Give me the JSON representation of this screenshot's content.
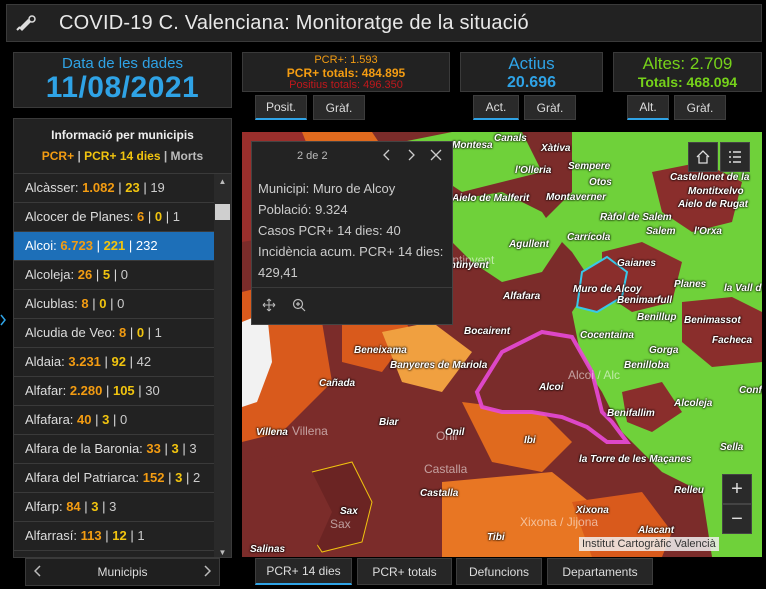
{
  "header": {
    "title": "COVID-19 C. Valenciana: Monitoratge de la situació"
  },
  "date_panel": {
    "label": "Data de les dades",
    "value": "11/08/2021"
  },
  "pcr_panel": {
    "line1": "PCR+: 1.593",
    "line2": "PCR+ totals: 484.895",
    "line3": "Positius totals: 496.350"
  },
  "actius_panel": {
    "label": "Actius",
    "value": "20.696"
  },
  "altes_panel": {
    "line1": "Altes: 2.709",
    "line2": "Totals: 468.094"
  },
  "tabs": {
    "posit": "Posit.",
    "graf1": "Gràf.",
    "act": "Act.",
    "graf2": "Gràf.",
    "alt": "Alt.",
    "graf3": "Gràf."
  },
  "municipis": {
    "title": "Informació per municipis",
    "legend_pcr": "PCR+",
    "legend_sep1": " | ",
    "legend_14": "PCR+ 14 dies",
    "legend_sep2": " | ",
    "legend_morts": "Morts",
    "sep": " | ",
    "rows": [
      {
        "name": "Alcàsser:",
        "a": "1.082",
        "b": "23",
        "c": "19"
      },
      {
        "name": "Alcocer de Planes:",
        "a": "6",
        "b": "0",
        "c": "1"
      },
      {
        "name": "Alcoi:",
        "a": "6.723",
        "b": "221",
        "c": "232"
      },
      {
        "name": "Alcoleja:",
        "a": "26",
        "b": "5",
        "c": "0"
      },
      {
        "name": "Alcublas:",
        "a": "8",
        "b": "0",
        "c": "0"
      },
      {
        "name": "Alcudia de Veo:",
        "a": "8",
        "b": "0",
        "c": "1"
      },
      {
        "name": "Aldaia:",
        "a": "3.231",
        "b": "92",
        "c": "42"
      },
      {
        "name": "Alfafar:",
        "a": "2.280",
        "b": "105",
        "c": "30"
      },
      {
        "name": "Alfafara:",
        "a": "40",
        "b": "3",
        "c": "0"
      },
      {
        "name": "Alfara de la Baronia:",
        "a": "33",
        "b": "3",
        "c": "3"
      },
      {
        "name": "Alfara del Patriarca:",
        "a": "152",
        "b": "3",
        "c": "2"
      },
      {
        "name": "Alfarp:",
        "a": "84",
        "b": "3",
        "c": "3"
      },
      {
        "name": "Alfarrasí:",
        "a": "113",
        "b": "12",
        "c": "1"
      }
    ],
    "nav_label": "Municipis"
  },
  "popup": {
    "counter": "2 de 2",
    "line1": "Municipi: Muro de Alcoy",
    "line2": "Població: 9.324",
    "line3": "Casos PCR+ 14 dies: 40",
    "line4": "Incidència acum. PCR+ 14 dies: 429,41"
  },
  "map": {
    "attribution": "Institut Cartogràfic Valencià",
    "labels": {
      "montesa": "Montesa",
      "canals": "Canals",
      "xativa": "Xàtiva",
      "lolleria": "l'Olleria",
      "sempere": "Sempere",
      "otos": "Otos",
      "castellonet": "Castellonet de la",
      "montitxelvo": "Montitxelvo",
      "aielo_salem": "Aielo de Rugat",
      "aielo_malferit": "Aielo de Malferit",
      "montaverner": "Montaverner",
      "rafol": "Ràfol de Salem",
      "salem": "Salem",
      "lorxa": "l'Orxa",
      "ontinyent_big": "Ontinyent",
      "agullent": "Agullent",
      "carricola": "Carrícola",
      "ontinyent": "Ontinyent",
      "gaianes": "Gaianes",
      "planes": "Planes",
      "lavall": "la Vall d",
      "alfafara": "Alfafara",
      "muro": "Muro de Alcoy",
      "benimarfull": "Benimarfull",
      "benillup": "Benillup",
      "benimassot": "Benimassot",
      "bocairent": "Bocairent",
      "cocentaina": "Cocentaina",
      "facheca": "Facheca",
      "beneixama": "Beneixama",
      "gorga": "Gorga",
      "banyeres": "Banyeres de Mariola",
      "benilloba": "Benilloba",
      "canada": "Cañada",
      "alcoi": "Alcoi",
      "alcoi_big": "Alcoi / Alc",
      "confrides": "Confride",
      "alcoleja": "Alcoleja",
      "benifallim": "Benifallim",
      "biar": "Biar",
      "villena": "Villena",
      "villena_big": "Villena",
      "onil": "Onil",
      "onil_big": "Onil",
      "ibi": "Ibi",
      "sella": "Sella",
      "torre": "la Torre de les Maçanes",
      "castalla_big": "Castalla",
      "castalla": "Castalla",
      "relleu": "Relleu",
      "sax": "Sax",
      "sax_big": "Sax",
      "xixona": "Xixona",
      "xixona_big": "Xixona / Jijona",
      "alacant": "Alacant",
      "tibi": "Tibi",
      "salinas": "Salinas"
    }
  },
  "bottom_tabs": {
    "pcr14": "PCR+ 14 dies",
    "pcrtot": "PCR+ totals",
    "defuncions": "Defuncions",
    "departaments": "Departaments"
  },
  "colors": {
    "accent": "#2fa3e6",
    "orange": "#f39c12",
    "yellow": "#f1c40f",
    "red": "#c0181c",
    "green": "#76d21a"
  }
}
